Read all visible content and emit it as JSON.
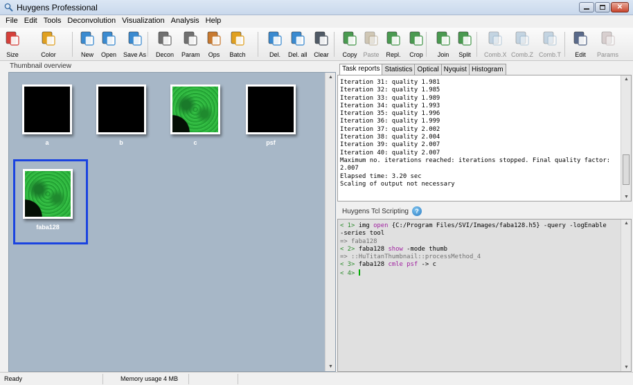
{
  "window": {
    "title": "Huygens Professional"
  },
  "menu": [
    "File",
    "Edit",
    "Tools",
    "Deconvolution",
    "Visualization",
    "Analysis",
    "Help"
  ],
  "toolbar": [
    {
      "label": "Size",
      "icon": "size-icon",
      "color": "#d6403a",
      "enabled": true
    },
    {
      "label": "Color",
      "icon": "color-wheel-icon",
      "color": "#e0a020",
      "enabled": true
    },
    {
      "label": "New",
      "icon": "new-image-icon",
      "color": "#3a8ad0",
      "enabled": true
    },
    {
      "label": "Open",
      "icon": "open-icon",
      "color": "#3a8ad0",
      "enabled": true
    },
    {
      "label": "Save As",
      "icon": "save-as-icon",
      "color": "#3a8ad0",
      "enabled": true
    },
    {
      "label": "Decon",
      "icon": "decon-wand-icon",
      "color": "#707070",
      "enabled": true
    },
    {
      "label": "Param",
      "icon": "param-wand-icon",
      "color": "#707070",
      "enabled": true
    },
    {
      "label": "Ops",
      "icon": "wrench-icon",
      "color": "#c87a30",
      "enabled": true
    },
    {
      "label": "Batch",
      "icon": "gears-icon",
      "color": "#e0a020",
      "enabled": true
    },
    {
      "label": "Del.",
      "icon": "delete-icon",
      "color": "#3a8ad0",
      "enabled": true
    },
    {
      "label": "Del. all",
      "icon": "delete-all-icon",
      "color": "#3a8ad0",
      "enabled": true
    },
    {
      "label": "Clear",
      "icon": "clear-icon",
      "color": "#505a66",
      "enabled": true
    },
    {
      "label": "Copy",
      "icon": "copy-icon",
      "color": "#4a9a50",
      "enabled": true
    },
    {
      "label": "Paste",
      "icon": "paste-icon",
      "color": "#b0a080",
      "enabled": false
    },
    {
      "label": "Repl.",
      "icon": "replace-icon",
      "color": "#4a9a50",
      "enabled": true
    },
    {
      "label": "Crop",
      "icon": "crop-icon",
      "color": "#4a9a50",
      "enabled": true
    },
    {
      "label": "Join",
      "icon": "join-icon",
      "color": "#4a9a50",
      "enabled": true
    },
    {
      "label": "Split",
      "icon": "split-icon",
      "color": "#4a9a50",
      "enabled": true
    },
    {
      "label": "Comb.X",
      "icon": "combine-x-icon",
      "color": "#9ab8d0",
      "enabled": false
    },
    {
      "label": "Comb.Z",
      "icon": "combine-z-icon",
      "color": "#9ab8d0",
      "enabled": false
    },
    {
      "label": "Comb.T",
      "icon": "combine-t-icon",
      "color": "#9ab8d0",
      "enabled": false
    },
    {
      "label": "Edit",
      "icon": "edit-icon",
      "color": "#5a6a8a",
      "enabled": true
    },
    {
      "label": "Params",
      "icon": "params-icon",
      "color": "#c0b0b0",
      "enabled": false
    }
  ],
  "thumbnails": {
    "header": "Thumbnail overview",
    "items": [
      {
        "name": "a",
        "fill": "black"
      },
      {
        "name": "b",
        "fill": "black"
      },
      {
        "name": "c",
        "fill": "green"
      },
      {
        "name": "psf",
        "fill": "black"
      },
      {
        "name": "faba128",
        "fill": "green",
        "selected": true
      }
    ]
  },
  "tabs": [
    "Task reports",
    "Statistics",
    "Optical",
    "Nyquist",
    "Histogram"
  ],
  "task_report": {
    "lines": [
      "Iteration 31: quality 1.981",
      "Iteration 32: quality 1.985",
      "Iteration 33: quality 1.989",
      "Iteration 34: quality 1.993",
      "Iteration 35: quality 1.996",
      "Iteration 36: quality 1.999",
      "Iteration 37: quality 2.002",
      "Iteration 38: quality 2.004",
      "Iteration 39: quality 2.007",
      "Iteration 40: quality 2.007",
      "Maximum no. iterations reached: iterations stopped. Final quality factor:",
      "2.007",
      "Elapsed time: 3.20 sec",
      "Scaling of output not necessary"
    ]
  },
  "tcl": {
    "header": "Huygens Tcl Scripting",
    "help_glyph": "?",
    "prompt1": "< 1>",
    "cmd1_a": " img ",
    "cmd1_kw": "open",
    "cmd1_b": " {C:/Program Files/SVI/Images/faba128.h5} -query -logEnable",
    "cmd1_c": "-series tool",
    "out1": "=> faba128",
    "prompt2": "< 2>",
    "cmd2_a": " faba128 ",
    "cmd2_kw": "show",
    "cmd2_b": " -mode thumb",
    "out2": "=> ::HuTitanThumbnail::processMethod_4",
    "prompt3": "< 3>",
    "cmd3_a": " faba128 ",
    "cmd3_kw": "cmle psf",
    "cmd3_b": " -> c",
    "prompt4": "< 4>"
  },
  "status": {
    "ready": "Ready",
    "memory": "Memory usage 4 MB"
  }
}
